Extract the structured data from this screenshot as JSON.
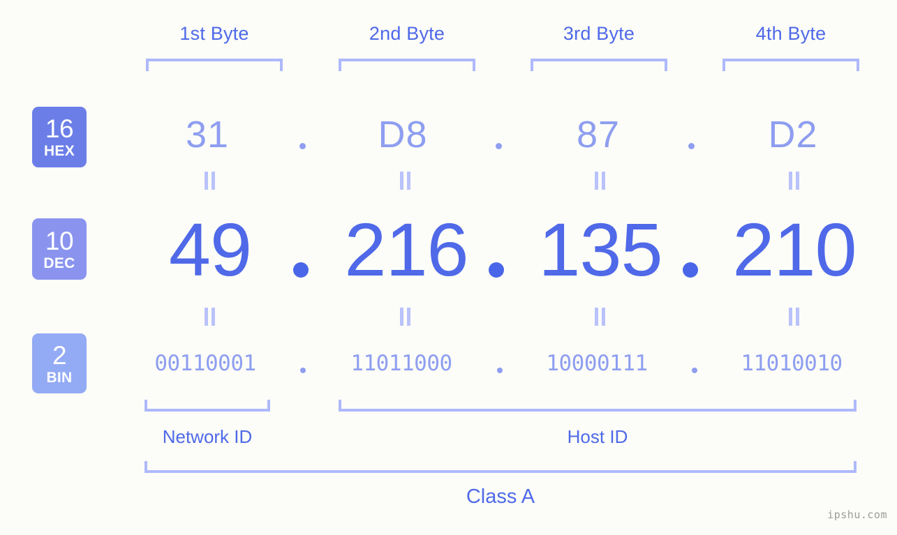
{
  "meta": {
    "watermark": "ipshu.com",
    "accent_strong": "#4f69e8",
    "accent_mid": "#8e9ef0",
    "accent_light": "#aeb9fb",
    "background": "#fcfdf8"
  },
  "byte_headers": [
    {
      "label": "1st Byte"
    },
    {
      "label": "2nd Byte"
    },
    {
      "label": "3rd Byte"
    },
    {
      "label": "4th Byte"
    }
  ],
  "bases": [
    {
      "number": "16",
      "name": "HEX",
      "color": "#6b7ee8"
    },
    {
      "number": "10",
      "name": "DEC",
      "color": "#8a94ef"
    },
    {
      "number": "2",
      "name": "BIN",
      "color": "#93aaf5"
    }
  ],
  "separator": ".",
  "rows": {
    "hex": {
      "values": [
        "31",
        "D8",
        "87",
        "D2"
      ]
    },
    "dec": {
      "values": [
        "49",
        "216",
        "135",
        "210"
      ]
    },
    "bin": {
      "values": [
        "00110001",
        "11011000",
        "10000111",
        "11010010"
      ]
    }
  },
  "equality_marks": [
    "=",
    "=",
    "=",
    "=",
    "=",
    "=",
    "=",
    "="
  ],
  "regions": [
    {
      "label": "Network ID"
    },
    {
      "label": "Host ID"
    }
  ],
  "class": {
    "label": "Class A"
  }
}
